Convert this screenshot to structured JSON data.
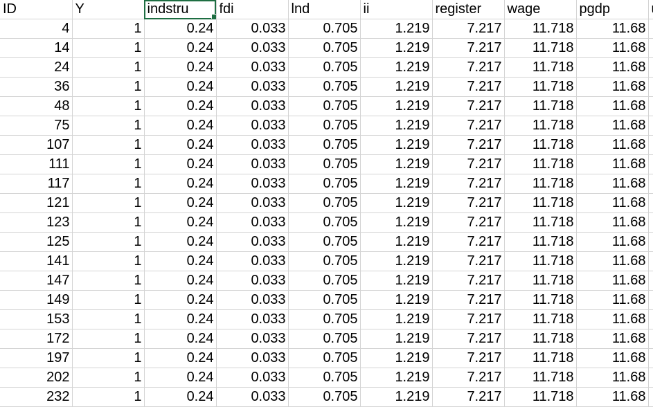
{
  "sheet": {
    "headers": [
      "ID",
      "Y",
      "indstru",
      "fdi",
      "lnd",
      "ii",
      "register",
      "wage",
      "pgdp",
      "u"
    ],
    "selected_header_index": 2,
    "rows": [
      [
        "4",
        "1",
        "0.24",
        "0.033",
        "0.705",
        "1.219",
        "7.217",
        "11.718",
        "11.68",
        ""
      ],
      [
        "14",
        "1",
        "0.24",
        "0.033",
        "0.705",
        "1.219",
        "7.217",
        "11.718",
        "11.68",
        ""
      ],
      [
        "24",
        "1",
        "0.24",
        "0.033",
        "0.705",
        "1.219",
        "7.217",
        "11.718",
        "11.68",
        ""
      ],
      [
        "36",
        "1",
        "0.24",
        "0.033",
        "0.705",
        "1.219",
        "7.217",
        "11.718",
        "11.68",
        ""
      ],
      [
        "48",
        "1",
        "0.24",
        "0.033",
        "0.705",
        "1.219",
        "7.217",
        "11.718",
        "11.68",
        ""
      ],
      [
        "75",
        "1",
        "0.24",
        "0.033",
        "0.705",
        "1.219",
        "7.217",
        "11.718",
        "11.68",
        ""
      ],
      [
        "107",
        "1",
        "0.24",
        "0.033",
        "0.705",
        "1.219",
        "7.217",
        "11.718",
        "11.68",
        ""
      ],
      [
        "111",
        "1",
        "0.24",
        "0.033",
        "0.705",
        "1.219",
        "7.217",
        "11.718",
        "11.68",
        ""
      ],
      [
        "117",
        "1",
        "0.24",
        "0.033",
        "0.705",
        "1.219",
        "7.217",
        "11.718",
        "11.68",
        ""
      ],
      [
        "121",
        "1",
        "0.24",
        "0.033",
        "0.705",
        "1.219",
        "7.217",
        "11.718",
        "11.68",
        ""
      ],
      [
        "123",
        "1",
        "0.24",
        "0.033",
        "0.705",
        "1.219",
        "7.217",
        "11.718",
        "11.68",
        ""
      ],
      [
        "125",
        "1",
        "0.24",
        "0.033",
        "0.705",
        "1.219",
        "7.217",
        "11.718",
        "11.68",
        ""
      ],
      [
        "141",
        "1",
        "0.24",
        "0.033",
        "0.705",
        "1.219",
        "7.217",
        "11.718",
        "11.68",
        ""
      ],
      [
        "147",
        "1",
        "0.24",
        "0.033",
        "0.705",
        "1.219",
        "7.217",
        "11.718",
        "11.68",
        ""
      ],
      [
        "149",
        "1",
        "0.24",
        "0.033",
        "0.705",
        "1.219",
        "7.217",
        "11.718",
        "11.68",
        ""
      ],
      [
        "153",
        "1",
        "0.24",
        "0.033",
        "0.705",
        "1.219",
        "7.217",
        "11.718",
        "11.68",
        ""
      ],
      [
        "172",
        "1",
        "0.24",
        "0.033",
        "0.705",
        "1.219",
        "7.217",
        "11.718",
        "11.68",
        ""
      ],
      [
        "197",
        "1",
        "0.24",
        "0.033",
        "0.705",
        "1.219",
        "7.217",
        "11.718",
        "11.68",
        ""
      ],
      [
        "202",
        "1",
        "0.24",
        "0.033",
        "0.705",
        "1.219",
        "7.217",
        "11.718",
        "11.68",
        ""
      ],
      [
        "232",
        "1",
        "0.24",
        "0.033",
        "0.705",
        "1.219",
        "7.217",
        "11.718",
        "11.68",
        ""
      ]
    ]
  },
  "colors": {
    "gridline": "#d4d4d4",
    "selection": "#1e6e42",
    "text": "#000000"
  }
}
